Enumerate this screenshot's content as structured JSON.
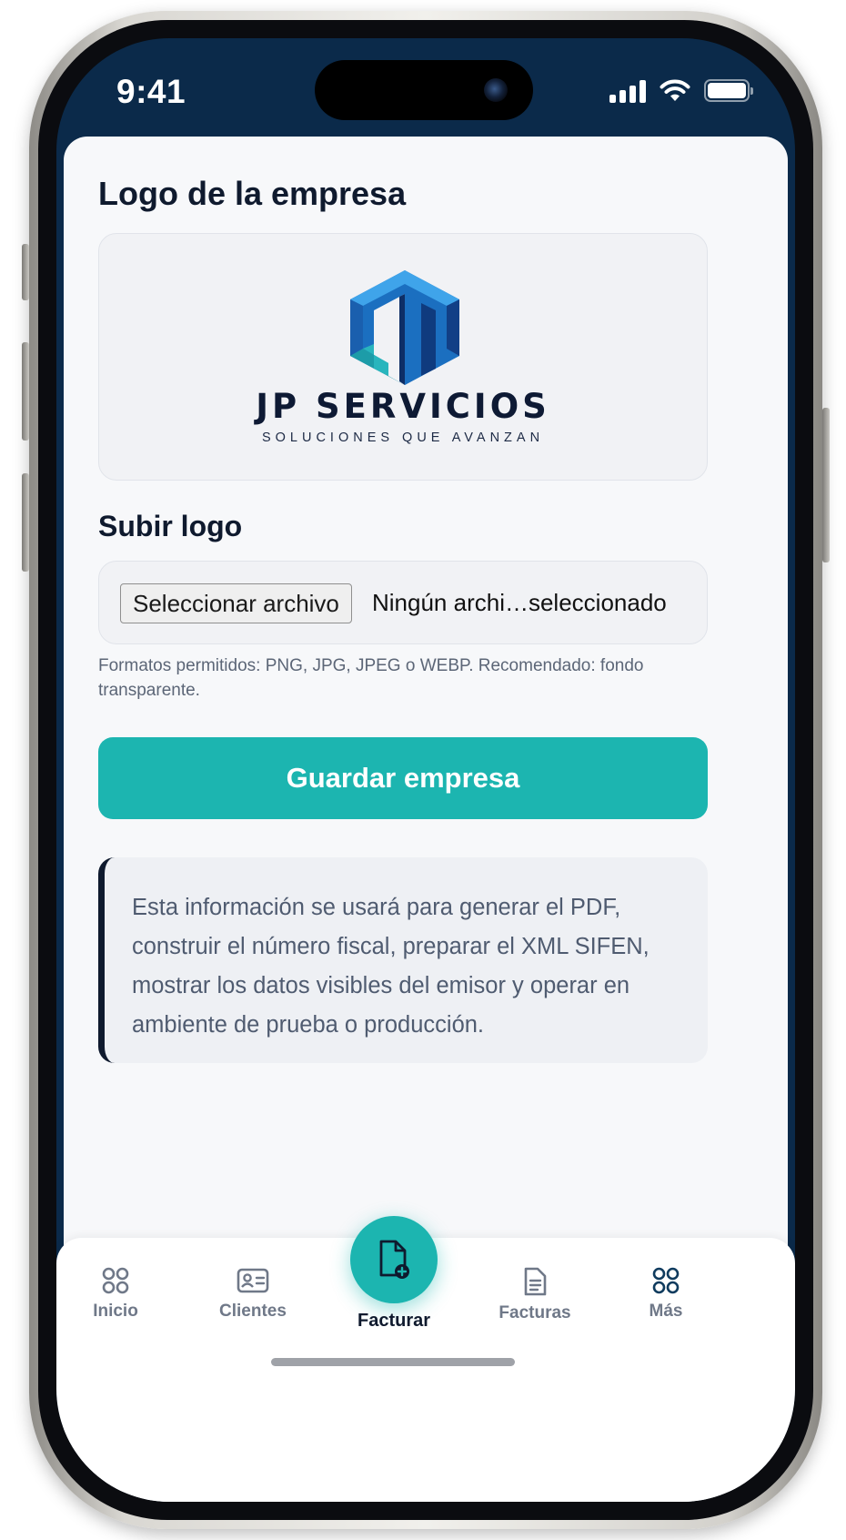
{
  "status_bar": {
    "time": "9:41"
  },
  "company_logo": {
    "section_title": "Logo de la empresa",
    "brand_name": "JP SERVICIOS",
    "tagline": "SOLUCIONES QUE AVANZAN"
  },
  "upload": {
    "section_title": "Subir logo",
    "file_button_label": "Seleccionar archivo",
    "file_status": "Ningún archi…seleccionado",
    "help_text": "Formatos permitidos: PNG, JPG, JPEG o WEBP. Recomendado: fondo transparente."
  },
  "actions": {
    "save_label": "Guardar empresa"
  },
  "info": {
    "text": "Esta información se usará para generar el PDF, construir el número fiscal, preparar el XML SIFEN, mostrar los datos visibles del emisor y operar en ambiente de prueba o producción."
  },
  "tab_bar": {
    "items": [
      {
        "label": "Inicio",
        "icon": "grid-icon"
      },
      {
        "label": "Clientes",
        "icon": "id-card-icon"
      },
      {
        "label": "Facturar",
        "icon": "document-add-icon"
      },
      {
        "label": "Facturas",
        "icon": "receipt-icon"
      },
      {
        "label": "Más",
        "icon": "grid-icon"
      }
    ]
  },
  "colors": {
    "accent": "#1cb5b0",
    "navy": "#0f1a2e",
    "header_bg": "#0b2a4a",
    "logo_blue": "#1f7fd0"
  }
}
